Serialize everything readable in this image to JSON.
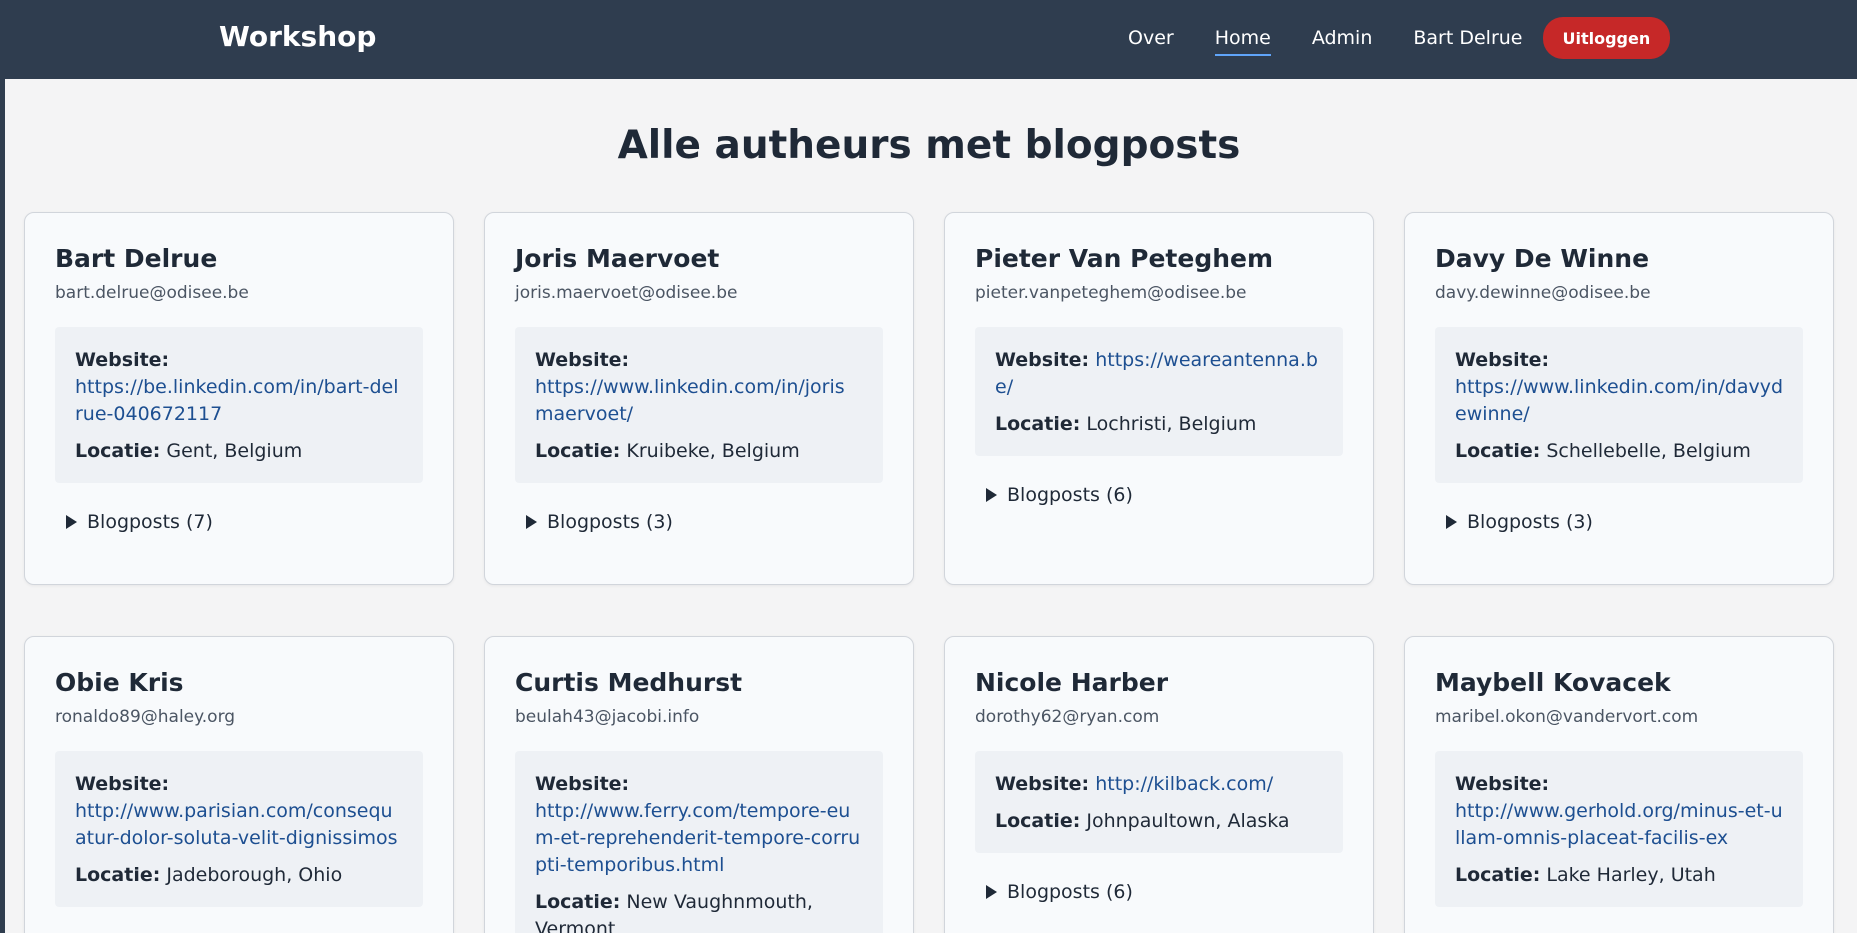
{
  "nav": {
    "brand": "Workshop",
    "links": [
      {
        "label": "Over"
      },
      {
        "label": "Home"
      },
      {
        "label": "Admin"
      }
    ],
    "user": "Bart Delrue",
    "logout": "Uitloggen"
  },
  "page": {
    "title": "Alle autheurs met blogposts",
    "website_label": "Website:",
    "location_label": "Locatie:"
  },
  "authors": [
    {
      "name": "Bart Delrue",
      "email": "bart.delrue@odisee.be",
      "website": "https://be.linkedin.com/in/bart-delrue-040672117",
      "location": "Gent, Belgium",
      "blogposts": "Blogposts (7)"
    },
    {
      "name": "Joris Maervoet",
      "email": "joris.maervoet@odisee.be",
      "website": "https://www.linkedin.com/in/jorismaervoet/",
      "location": "Kruibeke, Belgium",
      "blogposts": "Blogposts (3)"
    },
    {
      "name": "Pieter Van Peteghem",
      "email": "pieter.vanpeteghem@odisee.be",
      "website": "https://weareantenna.be/",
      "location": "Lochristi, Belgium",
      "blogposts": "Blogposts (6)"
    },
    {
      "name": "Davy De Winne",
      "email": "davy.dewinne@odisee.be",
      "website": "https://www.linkedin.com/in/davydewinne/",
      "location": "Schellebelle, Belgium",
      "blogposts": "Blogposts (3)"
    },
    {
      "name": "Obie Kris",
      "email": "ronaldo89@haley.org",
      "website": "http://www.parisian.com/consequatur-dolor-soluta-velit-dignissimos",
      "location": "Jadeborough, Ohio",
      "blogposts": ""
    },
    {
      "name": "Curtis Medhurst",
      "email": "beulah43@jacobi.info",
      "website": "http://www.ferry.com/tempore-eum-et-reprehenderit-tempore-corrupti-temporibus.html",
      "location": "New Vaughnmouth, Vermont",
      "blogposts": ""
    },
    {
      "name": "Nicole Harber",
      "email": "dorothy62@ryan.com",
      "website": "http://kilback.com/",
      "location": "Johnpaultown, Alaska",
      "blogposts": "Blogposts (6)"
    },
    {
      "name": "Maybell Kovacek",
      "email": "maribel.okon@vandervort.com",
      "website": "http://www.gerhold.org/minus-et-ullam-omnis-placeat-facilis-ex",
      "location": "Lake Harley, Utah",
      "blogposts": ""
    }
  ],
  "colors": {
    "navbar": "#2f3d4f",
    "logout": "#c62828",
    "link": "#1d4f91"
  }
}
